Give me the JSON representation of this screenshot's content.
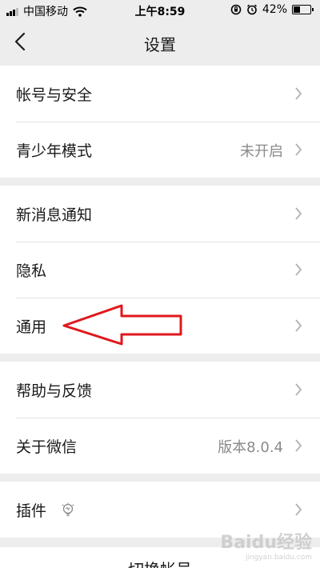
{
  "status_bar": {
    "carrier": "中国移动",
    "time": "上午8:59",
    "battery_percent": "42%",
    "battery_level": 0.42,
    "icons": [
      "signal-icon",
      "wifi-icon",
      "rotation-lock-icon",
      "alarm-icon",
      "battery-icon"
    ]
  },
  "nav": {
    "title": "设置",
    "back_icon": "chevron-left-icon"
  },
  "groups": [
    {
      "items": [
        {
          "label": "帐号与安全",
          "value": ""
        },
        {
          "label": "青少年模式",
          "value": "未开启"
        }
      ]
    },
    {
      "items": [
        {
          "label": "新消息通知",
          "value": ""
        },
        {
          "label": "隐私",
          "value": ""
        },
        {
          "label": "通用",
          "value": ""
        }
      ]
    },
    {
      "items": [
        {
          "label": "帮助与反馈",
          "value": ""
        },
        {
          "label": "关于微信",
          "value": "版本8.0.4"
        }
      ]
    },
    {
      "items": [
        {
          "label": "插件",
          "value": "",
          "icon": "lightbulb-icon"
        }
      ]
    }
  ],
  "bottom": {
    "label": "切换帐号"
  },
  "annotation": {
    "arrow_color": "#e0171c"
  },
  "watermark": {
    "text": "Baidu经验",
    "url": "jingyan.baidu.com"
  }
}
